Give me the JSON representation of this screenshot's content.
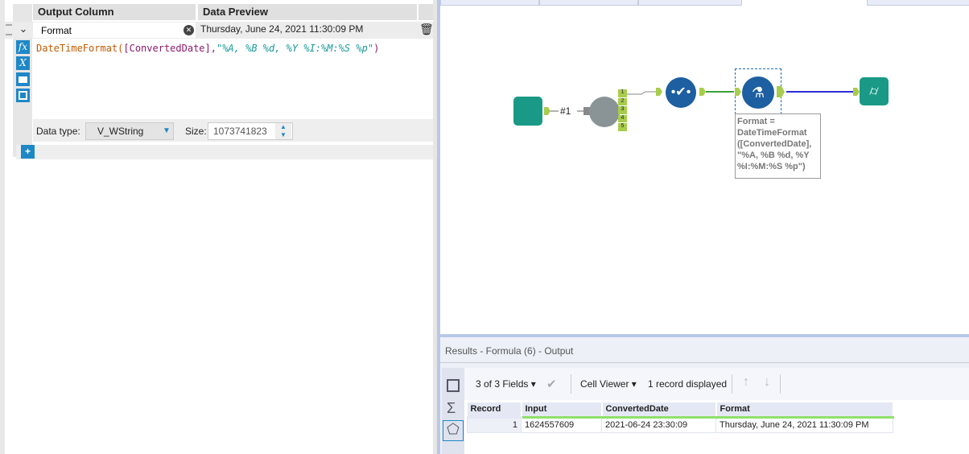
{
  "formula": {
    "header_output_column": "Output Column",
    "header_data_preview": "Data Preview",
    "output_column": "Format",
    "data_preview": "Thursday, June 24, 2021 11:30:09 PM",
    "expr_func": "DateTimeFormat(",
    "expr_field": "[ConvertedDate]",
    "expr_comma": ",",
    "expr_string": "\"%A, %B %d, %Y %I:%M:%S %p\"",
    "expr_close": ")",
    "data_type_label": "Data type:",
    "data_type_value": "V_WString",
    "size_label": "Size:",
    "size_value": "1073741823",
    "side_icons": {
      "fx": "fx",
      "x": "X"
    },
    "add_label": "+"
  },
  "canvas": {
    "connection_label": "#1",
    "python_outputs": [
      "1",
      "2",
      "3",
      "4",
      "5"
    ],
    "annotation": "Format = DateTimeFormat ([ConvertedDate], \"%A, %B %d, %Y %I:%M:%S %p\")"
  },
  "results": {
    "title": "Results - Formula (6) - Output",
    "fields": "3 of 3 Fields",
    "viewer": "Cell Viewer",
    "records": "1 record displayed",
    "columns": [
      "Record",
      "Input",
      "ConvertedDate",
      "Format"
    ],
    "rows": [
      [
        "1",
        "1624557609",
        "2021-06-24 23:30:09",
        "Thursday, June 24, 2021 11:30:09 PM"
      ]
    ]
  },
  "colors": {
    "accent": "#1e88c7",
    "tool_teal": "#16a085",
    "tool_blue": "#1d5fa0",
    "anchor": "#a8cc4c"
  }
}
